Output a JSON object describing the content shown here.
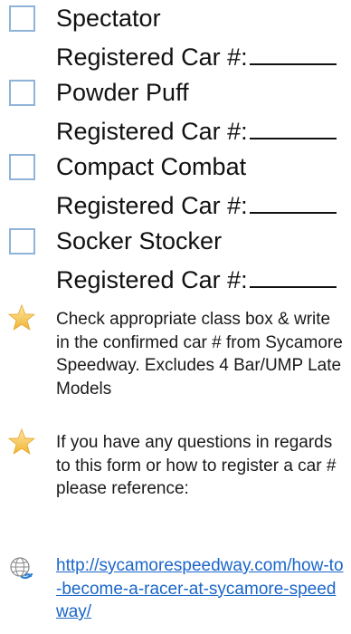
{
  "classes": [
    {
      "label": "Spectator",
      "reg_label": "Registered Car #:"
    },
    {
      "label": "Powder Puff",
      "reg_label": "Registered Car #:"
    },
    {
      "label": "Compact Combat",
      "reg_label": "Registered Car #:"
    },
    {
      "label": "Socker Stocker",
      "reg_label": "Registered Car #:"
    }
  ],
  "notes": [
    "Check appropriate class box & write in the confirmed car # from Sycamore Speedway. Excludes 4 Bar/UMP Late Models",
    "If you have any questions in regards to this form or how to register a car # please reference:"
  ],
  "link": {
    "text": "http://sycamorespeedway.com/how-to-become-a-racer-at-sycamore-speedway/"
  },
  "icons": {
    "note": "star-icon",
    "link": "globe-icon"
  },
  "colors": {
    "checkbox_border": "#8fb3d9",
    "link": "#1a66c9",
    "star": "#f5c242"
  }
}
